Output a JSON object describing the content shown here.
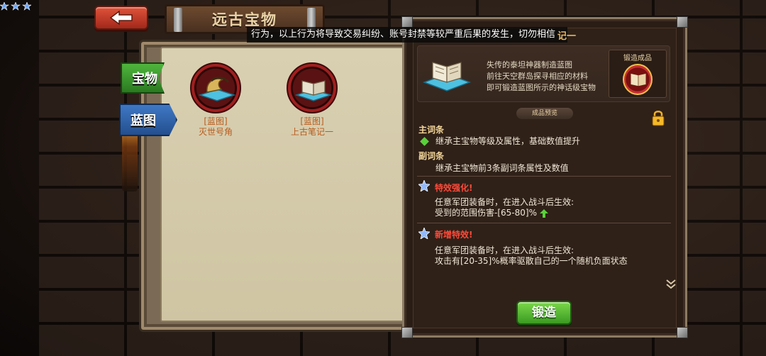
{
  "header": {
    "title": "远古宝物"
  },
  "toast": {
    "text": "行为，以上行为将导致交易纠纷、账号封禁等较严重后果的发生，切勿相信",
    "title_tail": "记一"
  },
  "tabs": [
    {
      "label": "宝物"
    },
    {
      "label": "蓝图"
    }
  ],
  "items": [
    {
      "tag": "[蓝图]",
      "name": "灭世号角"
    },
    {
      "tag": "[蓝图]",
      "name": "上古笔记一"
    }
  ],
  "detail": {
    "description": [
      "失传的泰坦神器制造蓝图",
      "前往天空群岛探寻相应的材料",
      "即可锻造蓝图所示的神话级宝物"
    ],
    "forge_result_label": "锻造成品",
    "preview_label": "成品预览",
    "main_title": "主词条",
    "main_text": "继承主宝物等级及属性，基础数值提升",
    "sub_title": "副词条",
    "sub_text": "继承主宝物前3条副词条属性及数值",
    "effect1": {
      "title": "特效强化!",
      "line1": "任意军团装备时，在进入战斗后生效:",
      "line2": "受到的范围伤害-[65-80]%"
    },
    "effect2": {
      "title": "新增特效!",
      "line1": "任意军团装备时，在进入战斗后生效:",
      "line2": "攻击有[20-35]%概率驱散自己的一个随机负面状态"
    },
    "forge_button": "锻造"
  },
  "colors": {
    "accent_green": "#59d13a",
    "effect_red": "#ff4a3a",
    "item_orange": "#b85b1d"
  }
}
